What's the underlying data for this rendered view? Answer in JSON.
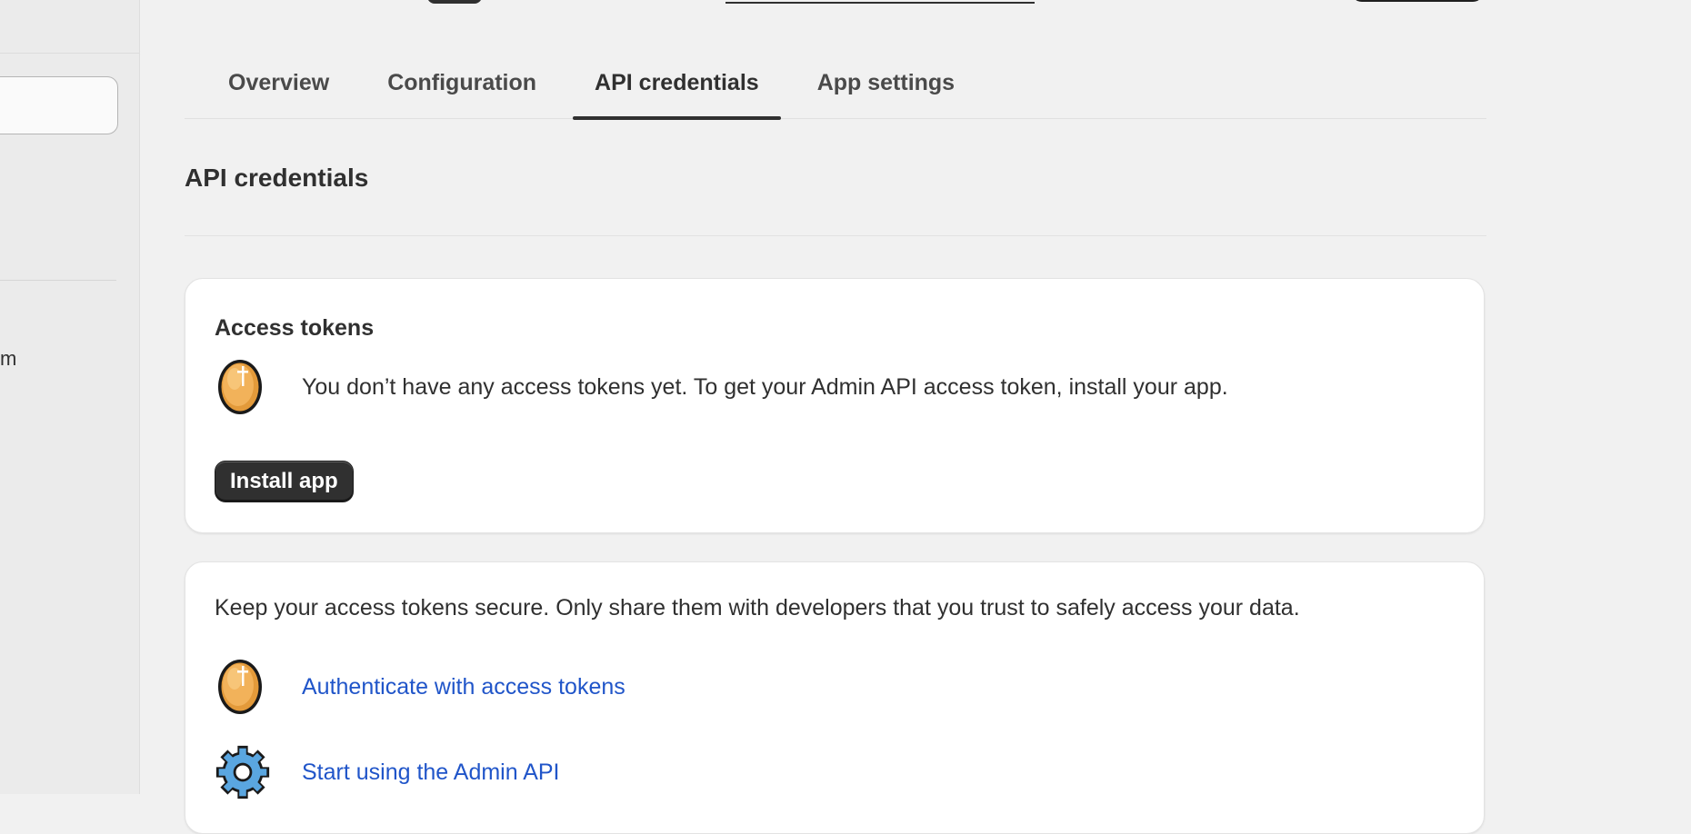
{
  "sidebar": {
    "partial_item_label": "m"
  },
  "tabs": [
    {
      "label": "Overview",
      "active": false
    },
    {
      "label": "Configuration",
      "active": false
    },
    {
      "label": "API credentials",
      "active": true
    },
    {
      "label": "App settings",
      "active": false
    }
  ],
  "section": {
    "title": "API credentials"
  },
  "access_tokens_card": {
    "heading": "Access tokens",
    "message": "You don’t have any access tokens yet. To get your Admin API access token, install your app.",
    "install_button_label": "Install app",
    "icon": "coin-icon"
  },
  "security_card": {
    "message": "Keep your access tokens secure. Only share them with developers that you trust to safely access your data.",
    "links": [
      {
        "label": "Authenticate with access tokens",
        "icon": "coin-icon"
      },
      {
        "label": "Start using the Admin API",
        "icon": "gear-icon"
      }
    ]
  },
  "colors": {
    "link": "#2055c9",
    "primary_button": "#303030",
    "background": "#f1f1f1",
    "coin": "#f2b25a"
  }
}
